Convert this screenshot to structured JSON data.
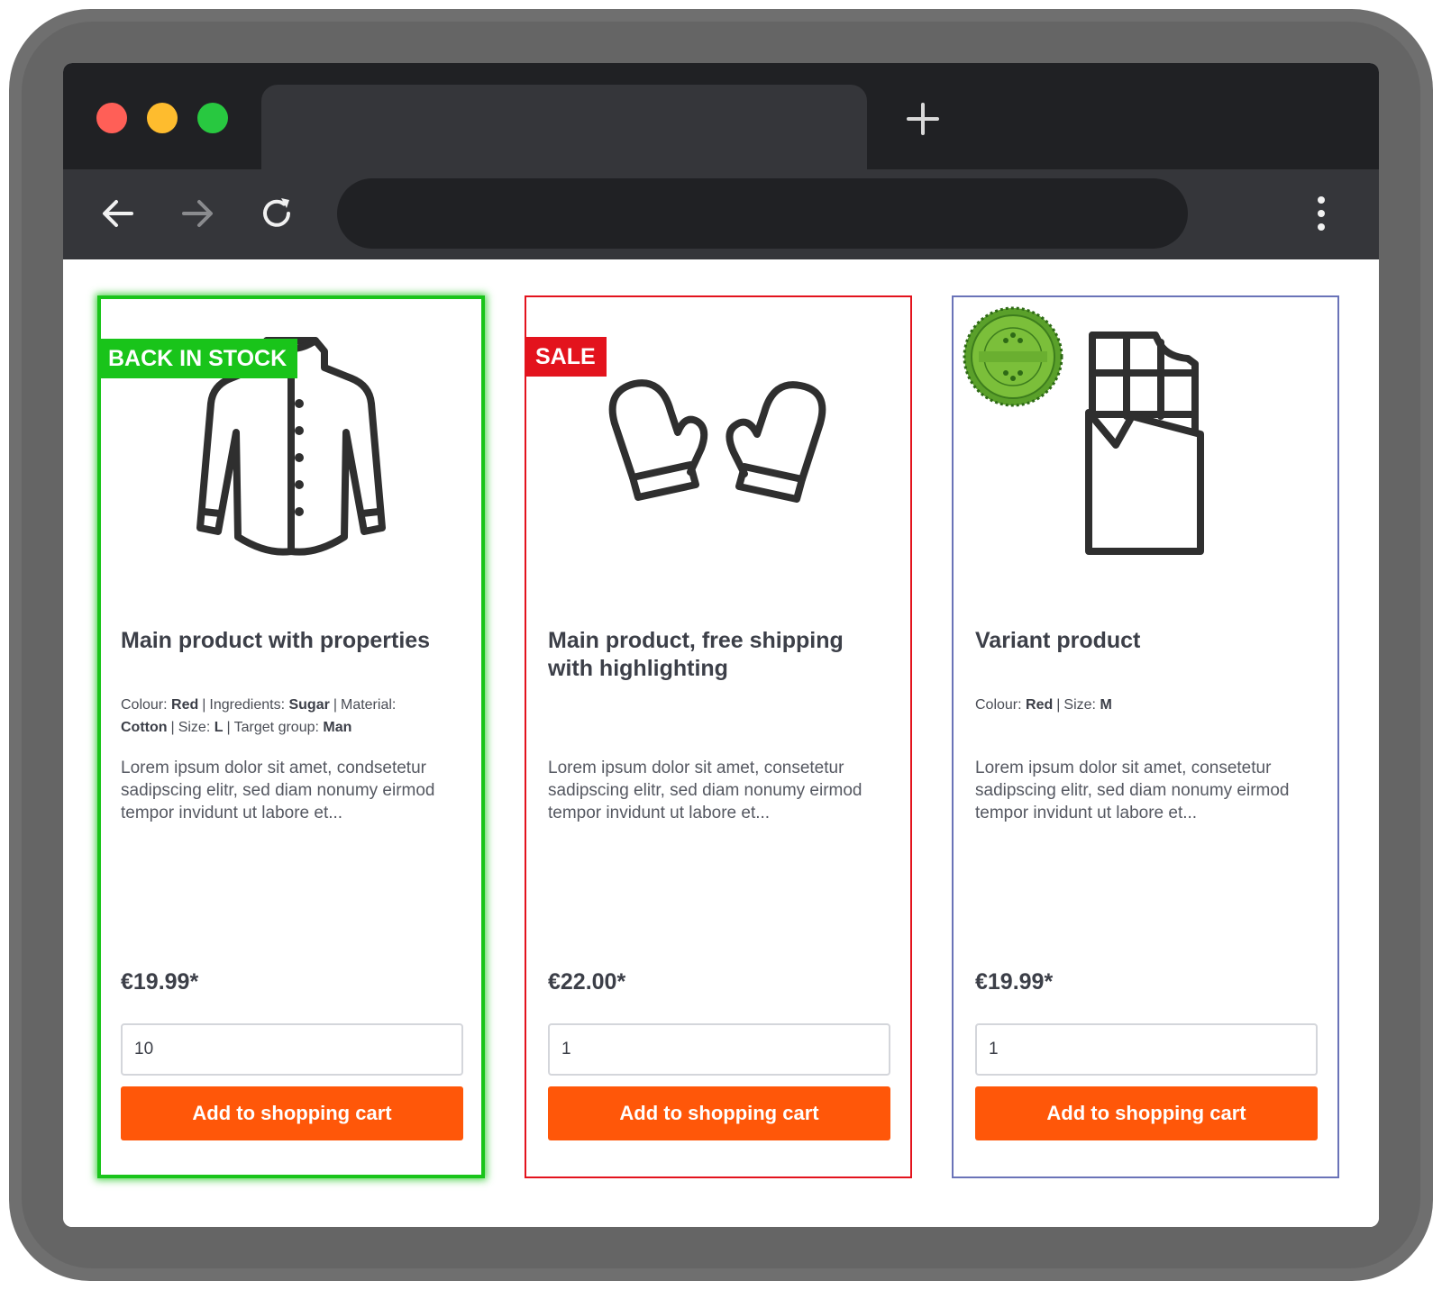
{
  "browser": {
    "new_tab_icon": "plus-icon",
    "back_icon": "arrow-left-icon",
    "forward_icon": "arrow-right-icon",
    "reload_icon": "reload-icon",
    "menu_icon": "kebab-menu-icon",
    "address_value": ""
  },
  "colors": {
    "accent_button": "#ff5709",
    "back_in_stock": "#19c41a",
    "sale": "#e3131d",
    "variant_border": "#6a73b8"
  },
  "products": [
    {
      "badge": "BACK IN STOCK",
      "image_icon": "jacket-icon",
      "title": "Main product with properties",
      "properties": [
        {
          "label": "Colour:",
          "value": "Red"
        },
        {
          "label": "Ingredients:",
          "value": "Sugar"
        },
        {
          "label": "Material:",
          "value": "Cotton"
        },
        {
          "label": "Size:",
          "value": "L"
        },
        {
          "label": "Target group:",
          "value": "Man"
        }
      ],
      "description": "Lorem ipsum dolor sit amet, condsetetur sadipscing elitr, sed diam nonumy eirmod tempor invidunt ut labore et...",
      "price": "€19.99*",
      "quantity": "10",
      "button": "Add to shopping cart"
    },
    {
      "badge": "SALE",
      "image_icon": "mittens-icon",
      "title": "Main product, free shipping with highlighting",
      "properties": [],
      "description": "Lorem ipsum dolor sit amet, consetetur sadipscing elitr, sed diam nonumy eirmod tempor invidunt ut labore et...",
      "price": "€22.00*",
      "quantity": "1",
      "button": "Add to shopping cart"
    },
    {
      "badge": "",
      "seal_icon": "guaranteed-seal-icon",
      "image_icon": "chocolate-bar-icon",
      "title": "Variant product",
      "properties": [
        {
          "label": "Colour:",
          "value": "Red"
        },
        {
          "label": "Size:",
          "value": "M"
        }
      ],
      "description": "Lorem ipsum dolor sit amet, consetetur sadipscing elitr, sed diam nonumy eirmod tempor invidunt ut labore et...",
      "price": "€19.99*",
      "quantity": "1",
      "button": "Add to shopping cart"
    }
  ]
}
